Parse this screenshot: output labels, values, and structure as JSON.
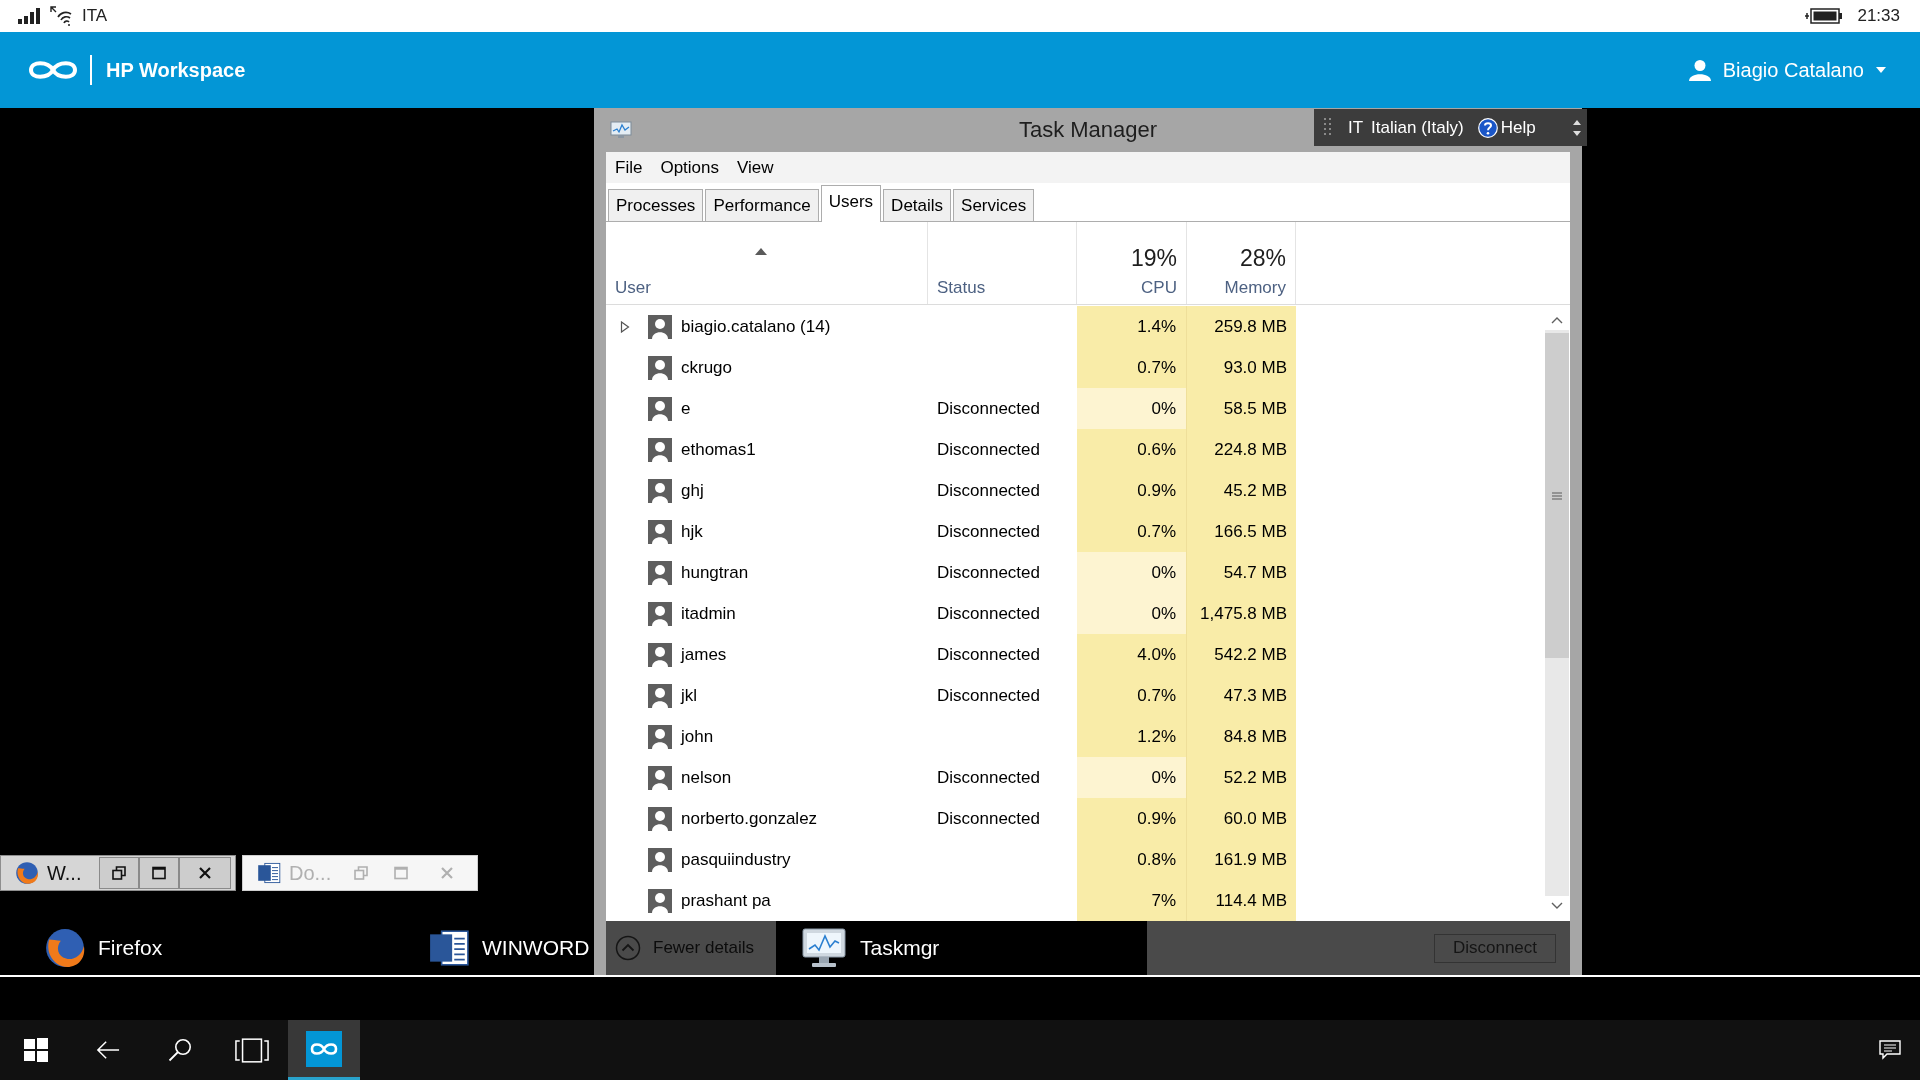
{
  "status_bar": {
    "network": "ITA",
    "time": "21:33"
  },
  "header": {
    "app_name": "HP Workspace",
    "user_name": "Biagio Catalano"
  },
  "task_manager": {
    "title": "Task Manager",
    "language_bar": {
      "code": "IT",
      "language": "Italian (Italy)",
      "help": "Help"
    },
    "menu": [
      "File",
      "Options",
      "View"
    ],
    "tabs": [
      {
        "label": "Processes",
        "selected": false
      },
      {
        "label": "Performance",
        "selected": false
      },
      {
        "label": "Users",
        "selected": true
      },
      {
        "label": "Details",
        "selected": false
      },
      {
        "label": "Services",
        "selected": false
      }
    ],
    "columns": {
      "user": "User",
      "status": "Status",
      "cpu": {
        "label": "CPU",
        "total": "19%"
      },
      "memory": {
        "label": "Memory",
        "total": "28%"
      }
    },
    "rows": [
      {
        "kind": "group",
        "expanded": false,
        "user": "biagio.catalano (14)",
        "cpu": {
          "value": "1.4%",
          "color": "#f9eca8"
        },
        "memory": "259.8 MB"
      },
      {
        "kind": "user",
        "user": "ckrugo",
        "cpu": {
          "value": "0.7%",
          "color": "#f9eca8"
        },
        "memory": "93.0 MB"
      },
      {
        "kind": "user",
        "user": "e",
        "status": "Disconnected",
        "cpu": {
          "value": "0%",
          "color": "#fdf4d1"
        },
        "memory": "58.5 MB"
      },
      {
        "kind": "user",
        "user": "ethomas1",
        "status": "Disconnected",
        "cpu": {
          "value": "0.6%",
          "color": "#f9eca8"
        },
        "memory": "224.8 MB"
      },
      {
        "kind": "user",
        "user": "ghj",
        "status": "Disconnected",
        "cpu": {
          "value": "0.9%",
          "color": "#f9eca8"
        },
        "memory": "45.2 MB"
      },
      {
        "kind": "user",
        "user": "hjk",
        "status": "Disconnected",
        "cpu": {
          "value": "0.7%",
          "color": "#f9eca8"
        },
        "memory": "166.5 MB"
      },
      {
        "kind": "user",
        "user": "hungtran",
        "status": "Disconnected",
        "cpu": {
          "value": "0%",
          "color": "#fdf4d1"
        },
        "memory": "54.7 MB"
      },
      {
        "kind": "user",
        "user": "itadmin",
        "status": "Disconnected",
        "cpu": {
          "value": "0%",
          "color": "#fdf4d1"
        },
        "memory": "1,475.8 MB"
      },
      {
        "kind": "user",
        "user": "james",
        "status": "Disconnected",
        "cpu": {
          "value": "4.0%",
          "color": "#f9eca8"
        },
        "memory": "542.2 MB"
      },
      {
        "kind": "user",
        "user": "jkl",
        "status": "Disconnected",
        "cpu": {
          "value": "0.7%",
          "color": "#f9eca8"
        },
        "memory": "47.3 MB"
      },
      {
        "kind": "user",
        "user": "john",
        "cpu": {
          "value": "1.2%",
          "color": "#f9eca8"
        },
        "memory": "84.8 MB"
      },
      {
        "kind": "user",
        "user": "nelson",
        "status": "Disconnected",
        "cpu": {
          "value": "0%",
          "color": "#fdf4d1"
        },
        "memory": "52.2 MB"
      },
      {
        "kind": "user",
        "user": "norberto.gonzalez",
        "status": "Disconnected",
        "cpu": {
          "value": "0.9%",
          "color": "#f9eca8"
        },
        "memory": "60.0 MB"
      },
      {
        "kind": "user",
        "user": "pasquiindustry",
        "cpu": {
          "value": "0.8%",
          "color": "#f9eca8"
        },
        "memory": "161.9 MB"
      },
      {
        "kind": "user",
        "user": "prashant pa",
        "cpu": {
          "value": "7%",
          "color": "#f9eca8"
        },
        "memory": "114.4 MB"
      }
    ],
    "fewer_details": "Fewer details",
    "disconnect_button": {
      "label": "Disconnect",
      "disabled": true
    }
  },
  "minimized_windows": [
    {
      "kind": "firefox",
      "title": "W...",
      "active": true
    },
    {
      "kind": "word",
      "title": "Do...",
      "active": false
    }
  ],
  "remote_taskbar": [
    {
      "kind": "firefox",
      "label": "Firefox",
      "selected": false
    },
    {
      "kind": "word",
      "label": "WINWORD",
      "selected": false
    },
    {
      "kind": "taskmgr",
      "label": "Taskmgr",
      "selected": true
    }
  ],
  "system_taskbar": {
    "apps": [
      {
        "kind": "workspace",
        "selected": true
      }
    ]
  }
}
